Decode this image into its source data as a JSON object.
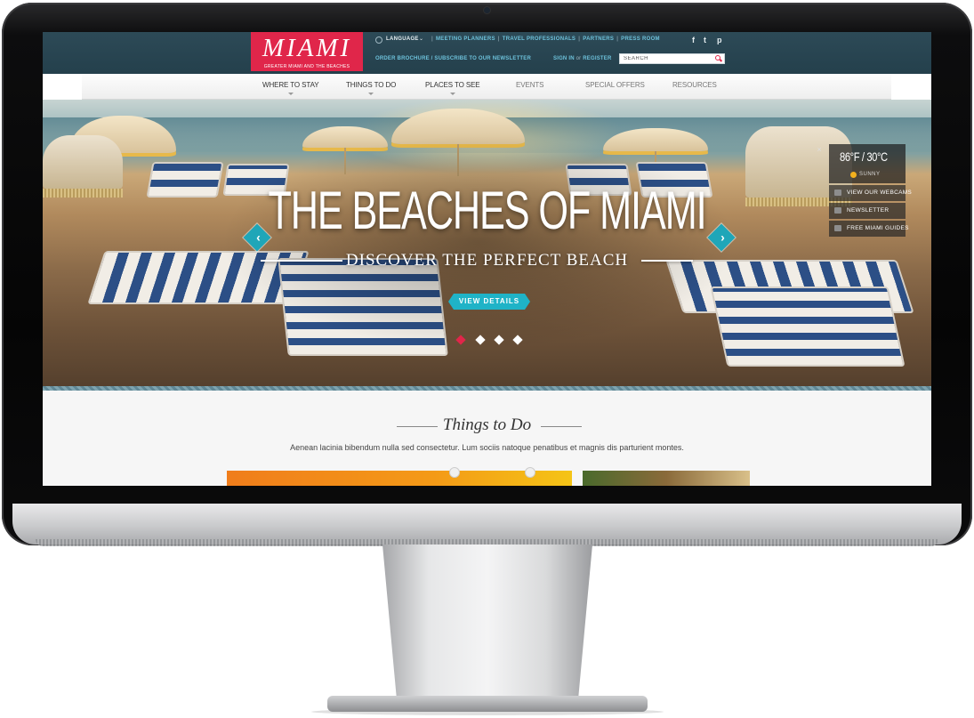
{
  "logo": {
    "main": "MIAMI",
    "sub": "GREATER MIAMI AND THE BEACHES"
  },
  "topbar": {
    "language_label": "LANGUAGE",
    "links": [
      "MEETING PLANNERS",
      "TRAVEL PROFESSIONALS",
      "PARTNERS",
      "PRESS ROOM"
    ],
    "order_link": "ORDER BROCHURE / SUBSCRIBE TO OUR NEWSLETTER",
    "sign_in": "SIGN IN",
    "or": "or",
    "register": "REGISTER",
    "search_placeholder": "SEARCH",
    "social": [
      "f",
      "t",
      "p"
    ]
  },
  "nav": {
    "items": [
      {
        "label": "WHERE TO STAY"
      },
      {
        "label": "THINGS TO DO"
      },
      {
        "label": "PLACES TO SEE"
      },
      {
        "label": "EVENTS"
      },
      {
        "label": "SPECIAL OFFERS"
      },
      {
        "label": "RESOURCES"
      }
    ]
  },
  "hero": {
    "title": "THE BEACHES OF MIAMI",
    "subtitle": "DISCOVER THE PERFECT BEACH",
    "cta": "VIEW DETAILS",
    "prev_arrow": "‹",
    "next_arrow": "›",
    "slides": 4,
    "active_slide": 1
  },
  "widget": {
    "close": "×",
    "temperature": "86°F / 30°C",
    "condition": "SUNNY",
    "buttons": [
      {
        "label": "VIEW OUR WEBCAMS",
        "icon": "camera-icon"
      },
      {
        "label": "NEWSLETTER",
        "icon": "envelope-icon"
      },
      {
        "label": "FREE MIAMI GUIDES",
        "icon": "guide-icon"
      }
    ]
  },
  "things": {
    "title": "Things to Do",
    "description": "Aenean lacinia bibendum nulla sed consectetur. Lum sociis natoque penatibus et magnis dis parturient montes."
  },
  "colors": {
    "brand": "#e0264a",
    "accent": "#1fb3c7",
    "topbar": "#2d4a57"
  }
}
